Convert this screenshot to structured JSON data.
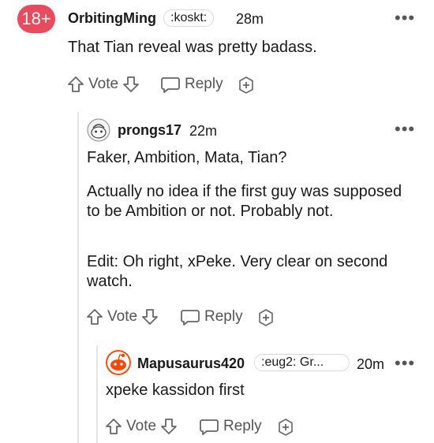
{
  "comments": [
    {
      "avatar_badge": "18+",
      "username": "OrbitingMing",
      "flair": ":koskt:",
      "time": "28m",
      "body": [
        "That Tian reveal was pretty badass."
      ],
      "actions": {
        "vote": "Vote",
        "reply": "Reply"
      }
    },
    {
      "username": "prongs17",
      "time": "22m",
      "body": [
        "Faker, Ambition, Mata, Tian?",
        "Actually no idea if the first guy was supposed to be Ambition or not. Probably not.",
        "Edit: Oh right, xPeke. Very clear on second watch."
      ],
      "actions": {
        "vote": "Vote",
        "reply": "Reply"
      }
    },
    {
      "username": "Mapusaurus420",
      "flair": ":eug2: Gr...",
      "time": "20m",
      "body": [
        "xpeke kassidon first"
      ],
      "actions": {
        "vote": "Vote",
        "reply": "Reply"
      }
    }
  ],
  "menu_glyph": "•••",
  "colors": {
    "badge": "#ea4a5b",
    "text": "#1a1a1b",
    "muted": "#555555",
    "reddit_orange": "#ff4500"
  }
}
